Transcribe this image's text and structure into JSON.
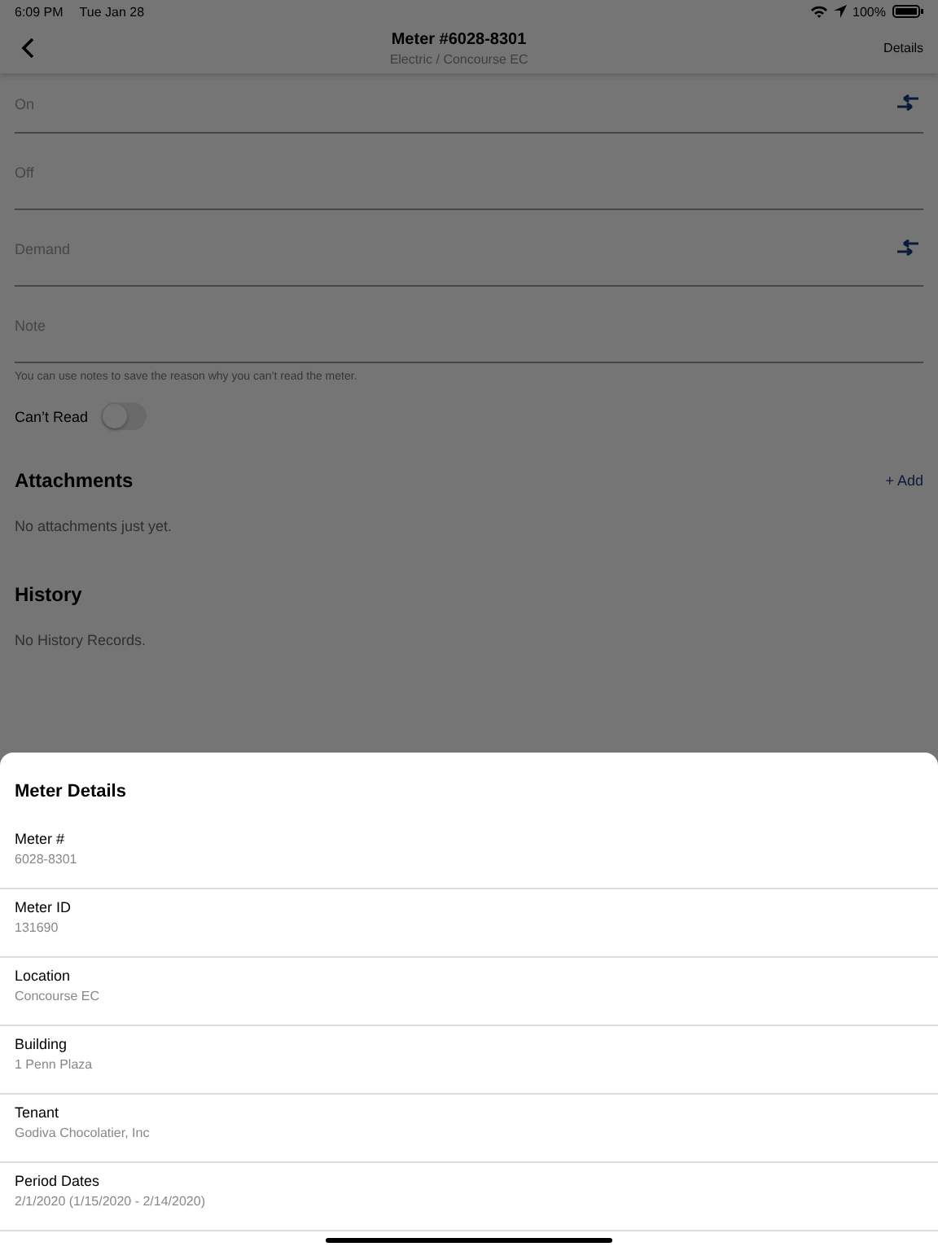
{
  "status_bar": {
    "time": "6:09 PM",
    "date": "Tue Jan 28",
    "battery": "100%"
  },
  "nav": {
    "title": "Meter #6028-8301",
    "subtitle": "Electric / Concourse EC",
    "action": "Details"
  },
  "fields": [
    {
      "placeholder": "On",
      "kind": "reading"
    },
    {
      "placeholder": "Off",
      "kind": "plain"
    },
    {
      "placeholder": "Demand",
      "kind": "reading"
    },
    {
      "placeholder": "Note",
      "kind": "plain"
    }
  ],
  "note_hint": "You can use notes to save the reason why you can’t read the meter.",
  "cant_read": {
    "label": "Can’t Read",
    "on": false
  },
  "attachments": {
    "title": "Attachments",
    "add": "+ Add",
    "empty": "No attachments just yet."
  },
  "history": {
    "title": "History",
    "empty": "No History Records."
  },
  "sheet": {
    "title": "Meter Details",
    "rows": [
      {
        "label": "Meter #",
        "value": "6028-8301"
      },
      {
        "label": "Meter ID",
        "value": "131690"
      },
      {
        "label": "Location",
        "value": "Concourse EC"
      },
      {
        "label": "Building",
        "value": "1 Penn Plaza"
      },
      {
        "label": "Tenant",
        "value": "Godiva Chocolatier, Inc"
      },
      {
        "label": "Period Dates",
        "value": "2/1/2020 (1/15/2020 - 2/14/2020)"
      }
    ]
  }
}
